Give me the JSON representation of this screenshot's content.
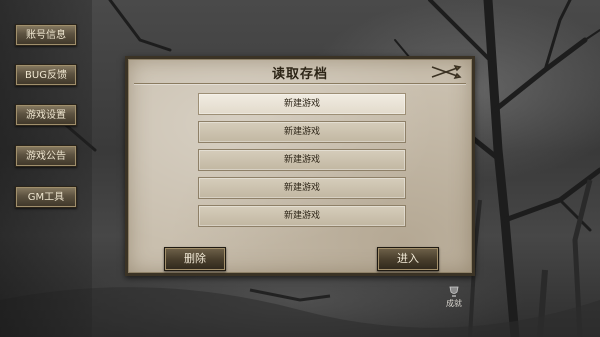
{
  "sidebar": {
    "items": [
      {
        "label": "账号信息"
      },
      {
        "label": "BUG反馈"
      },
      {
        "label": "游戏设置"
      },
      {
        "label": "游戏公告"
      },
      {
        "label": "GM工具"
      }
    ]
  },
  "dialog": {
    "title": "读取存档",
    "slots": [
      {
        "label": "新建游戏",
        "selected": true
      },
      {
        "label": "新建游戏"
      },
      {
        "label": "新建游戏"
      },
      {
        "label": "新建游戏"
      },
      {
        "label": "新建游戏"
      }
    ],
    "delete_label": "删除",
    "enter_label": "进入",
    "deco_icon": "crossed-arrows-icon"
  },
  "achievement": {
    "label": "成就"
  }
}
